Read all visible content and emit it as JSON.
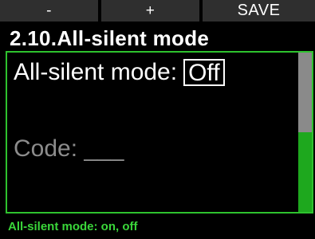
{
  "softkeys": {
    "left_label": "-",
    "middle_label": "+",
    "right_label": "SAVE"
  },
  "screen": {
    "title": "2.10.All-silent mode"
  },
  "settings": {
    "mode_label": "All-silent mode:",
    "mode_value": "Off",
    "code_label": "Code: ___"
  },
  "scroll": {
    "position_fraction": 0.5
  },
  "footer": {
    "hint": "All-silent mode: on, off"
  },
  "colors": {
    "accent_green": "#2ec22e",
    "hint_green": "#3ad63a",
    "softkey_bg": "#2f2f2f",
    "thumb_gray": "#8a8a8a"
  }
}
